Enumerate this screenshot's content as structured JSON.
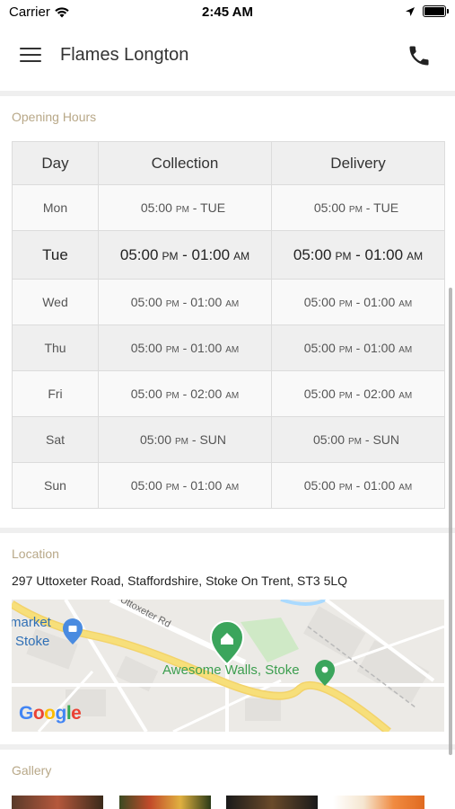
{
  "status_bar": {
    "carrier": "Carrier",
    "time": "2:45 AM"
  },
  "header": {
    "title": "Flames Longton",
    "menu_icon": "hamburger-menu-icon",
    "phone_icon": "phone-icon"
  },
  "opening_hours": {
    "section_label": "Opening Hours",
    "columns": [
      "Day",
      "Collection",
      "Delivery"
    ],
    "rows": [
      {
        "day": "Mon",
        "collection": {
          "start": "05:00",
          "start_ampm": "PM",
          "end": "TUE",
          "end_ampm": ""
        },
        "delivery": {
          "start": "05:00",
          "start_ampm": "PM",
          "end": "TUE",
          "end_ampm": ""
        }
      },
      {
        "day": "Tue",
        "collection": {
          "start": "05:00",
          "start_ampm": "PM",
          "end": "01:00",
          "end_ampm": "AM"
        },
        "delivery": {
          "start": "05:00",
          "start_ampm": "PM",
          "end": "01:00",
          "end_ampm": "AM"
        }
      },
      {
        "day": "Wed",
        "collection": {
          "start": "05:00",
          "start_ampm": "PM",
          "end": "01:00",
          "end_ampm": "AM"
        },
        "delivery": {
          "start": "05:00",
          "start_ampm": "PM",
          "end": "01:00",
          "end_ampm": "AM"
        }
      },
      {
        "day": "Thu",
        "collection": {
          "start": "05:00",
          "start_ampm": "PM",
          "end": "01:00",
          "end_ampm": "AM"
        },
        "delivery": {
          "start": "05:00",
          "start_ampm": "PM",
          "end": "01:00",
          "end_ampm": "AM"
        }
      },
      {
        "day": "Fri",
        "collection": {
          "start": "05:00",
          "start_ampm": "PM",
          "end": "02:00",
          "end_ampm": "AM"
        },
        "delivery": {
          "start": "05:00",
          "start_ampm": "PM",
          "end": "02:00",
          "end_ampm": "AM"
        }
      },
      {
        "day": "Sat",
        "collection": {
          "start": "05:00",
          "start_ampm": "PM",
          "end": "SUN",
          "end_ampm": ""
        },
        "delivery": {
          "start": "05:00",
          "start_ampm": "PM",
          "end": "SUN",
          "end_ampm": ""
        }
      },
      {
        "day": "Sun",
        "collection": {
          "start": "05:00",
          "start_ampm": "PM",
          "end": "01:00",
          "end_ampm": "AM"
        },
        "delivery": {
          "start": "05:00",
          "start_ampm": "PM",
          "end": "01:00",
          "end_ampm": "AM"
        }
      }
    ],
    "highlighted_day": "Tue"
  },
  "location": {
    "section_label": "Location",
    "address": "297 Uttoxeter Road, Staffordshire, Stoke On Trent, ST3 5LQ",
    "map": {
      "labels": {
        "place": "Awesome Walls, Stoke",
        "road": "Uttoxeter Rd",
        "city_top": "market",
        "city_bottom": "Stoke",
        "logo": "Google"
      },
      "colors": {
        "major_road": "#f7df7a",
        "park": "#cfe9c6",
        "water": "#aadaff",
        "pin_green": "#3ba55c",
        "pin_blue": "#4a8be0"
      }
    }
  },
  "gallery": {
    "section_label": "Gallery"
  },
  "colors": {
    "section_label": "#b8a888",
    "divider": "#efefef",
    "table_border": "#dcdcdc"
  }
}
